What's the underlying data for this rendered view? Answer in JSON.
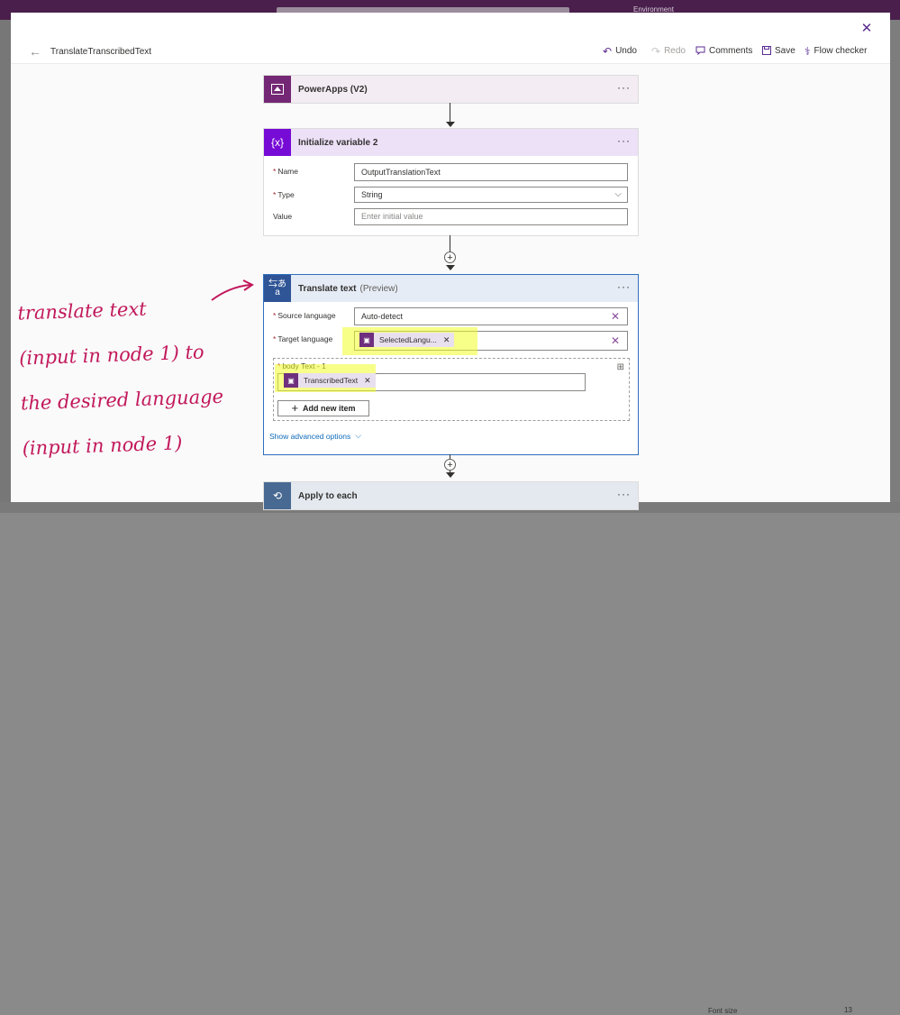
{
  "background": {
    "environment_label": "Environment",
    "font_size_label": "Font size",
    "font_size_value": "13"
  },
  "toolbar": {
    "flow_name": "TranslateTranscribedText",
    "undo": "Undo",
    "redo": "Redo",
    "comments": "Comments",
    "save": "Save",
    "flow_checker": "Flow checker"
  },
  "steps": {
    "powerapps": {
      "title": "PowerApps (V2)",
      "color": "#742774"
    },
    "init_var": {
      "title": "Initialize variable 2",
      "color": "#770bd6",
      "fields": {
        "name_label": "Name",
        "name_value": "OutputTranslationText",
        "type_label": "Type",
        "type_value": "String",
        "value_label": "Value",
        "value_placeholder": "Enter initial value"
      }
    },
    "translate": {
      "title": "Translate text",
      "subtitle": "(Preview)",
      "color": "#2f5596",
      "fields": {
        "source_label": "Source language",
        "source_value": "Auto-detect",
        "target_label": "Target language",
        "target_token": "SelectedLangu...",
        "body_label": "body Text - 1",
        "body_token": "TranscribedText",
        "add_item": "Add new item",
        "advanced": "Show advanced options"
      }
    },
    "apply_each": {
      "title": "Apply to each",
      "color": "#486991"
    }
  },
  "annotation": {
    "lines": [
      "translate text",
      "(input in node 1) to",
      "the desired language",
      "(input in node 1)"
    ],
    "color": "#c2185b"
  }
}
